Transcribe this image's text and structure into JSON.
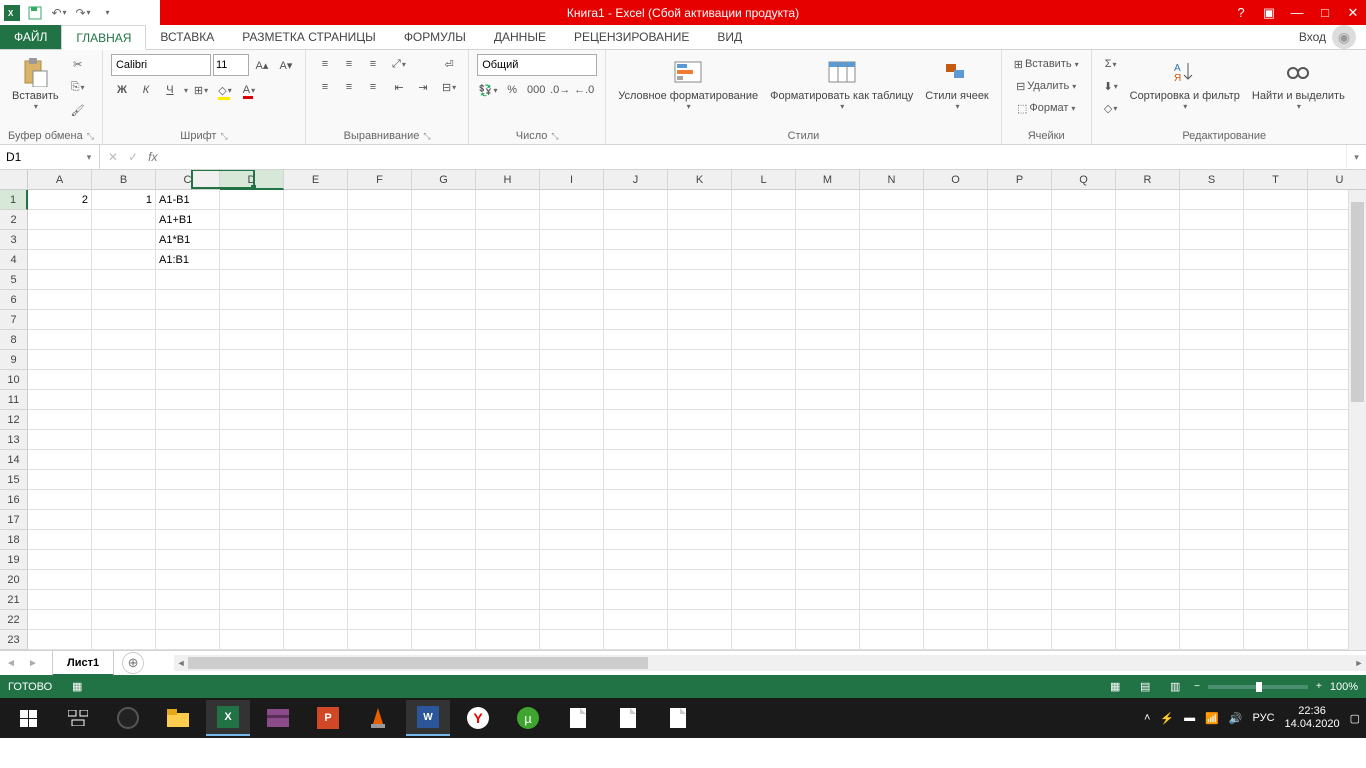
{
  "title": "Книга1 -  Excel (Сбой активации продукта)",
  "tabs": {
    "file": "ФАЙЛ",
    "list": [
      "ГЛАВНАЯ",
      "ВСТАВКА",
      "РАЗМЕТКА СТРАНИЦЫ",
      "ФОРМУЛЫ",
      "ДАННЫЕ",
      "РЕЦЕНЗИРОВАНИЕ",
      "ВИД"
    ],
    "active": 0,
    "signin": "Вход"
  },
  "ribbon": {
    "clipboard": {
      "paste": "Вставить",
      "label": "Буфер обмена"
    },
    "font": {
      "name": "Calibri",
      "size": "11",
      "bold": "Ж",
      "italic": "К",
      "underline": "Ч",
      "label": "Шрифт"
    },
    "align": {
      "label": "Выравнивание"
    },
    "number": {
      "format": "Общий",
      "label": "Число"
    },
    "styles": {
      "cond": "Условное форматирование",
      "table": "Форматировать как таблицу",
      "cell": "Стили ячеек",
      "label": "Стили"
    },
    "cells": {
      "insert": "Вставить",
      "delete": "Удалить",
      "format": "Формат",
      "label": "Ячейки"
    },
    "editing": {
      "sort": "Сортировка и фильтр",
      "find": "Найти и выделить",
      "label": "Редактирование"
    }
  },
  "namebox": "D1",
  "formula": "",
  "columns": [
    "A",
    "B",
    "C",
    "D",
    "E",
    "F",
    "G",
    "H",
    "I",
    "J",
    "K",
    "L",
    "M",
    "N",
    "O",
    "P",
    "Q",
    "R",
    "S",
    "T",
    "U"
  ],
  "rows": 23,
  "selected": {
    "col": 3,
    "row": 0
  },
  "cellsData": {
    "0": {
      "0": {
        "v": "2",
        "align": "r"
      },
      "1": {
        "v": "1",
        "align": "r"
      },
      "2": {
        "v": "A1-B1"
      }
    },
    "1": {
      "2": {
        "v": "A1+B1"
      }
    },
    "2": {
      "2": {
        "v": "A1*B1"
      }
    },
    "3": {
      "2": {
        "v": "A1:B1"
      }
    }
  },
  "sheet": {
    "name": "Лист1"
  },
  "status": {
    "ready": "ГОТОВО",
    "zoom": "100%"
  },
  "taskbar": {
    "lang": "РУС",
    "time": "22:36",
    "date": "14.04.2020"
  }
}
